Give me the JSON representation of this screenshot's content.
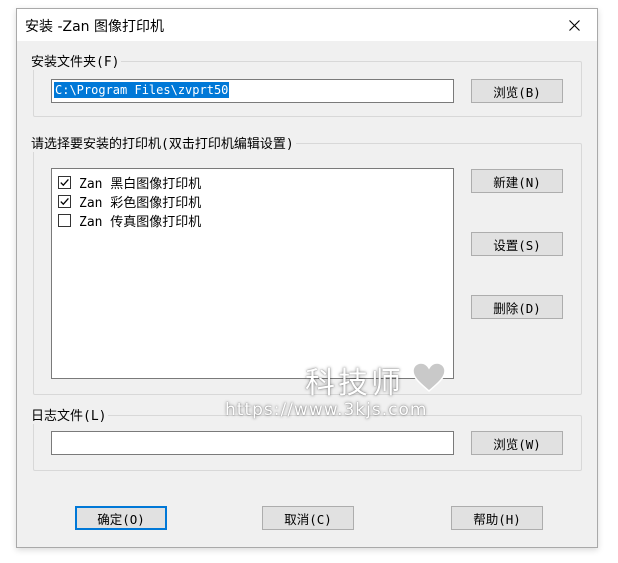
{
  "window": {
    "title": "安装 -Zan 图像打印机",
    "close_icon": "close-icon"
  },
  "install_folder": {
    "label": "安装文件夹(F)",
    "path": "C:\\Program Files\\zvprt50",
    "browse_label": "浏览(B)"
  },
  "printers": {
    "label": "请选择要安装的打印机(双击打印机编辑设置)",
    "items": [
      {
        "label": "Zan 黑白图像打印机",
        "checked": true
      },
      {
        "label": "Zan 彩色图像打印机",
        "checked": true
      },
      {
        "label": "Zan 传真图像打印机",
        "checked": false
      }
    ],
    "new_label": "新建(N)",
    "settings_label": "设置(S)",
    "delete_label": "删除(D)"
  },
  "log_file": {
    "label": "日志文件(L)",
    "value": "",
    "browse_label": "浏览(W)"
  },
  "footer": {
    "ok_label": "确定(O)",
    "cancel_label": "取消(C)",
    "help_label": "帮助(H)"
  },
  "watermark": {
    "title": "科技师",
    "url": "https://www.3kjs.com",
    "icon": "heart-icon"
  }
}
